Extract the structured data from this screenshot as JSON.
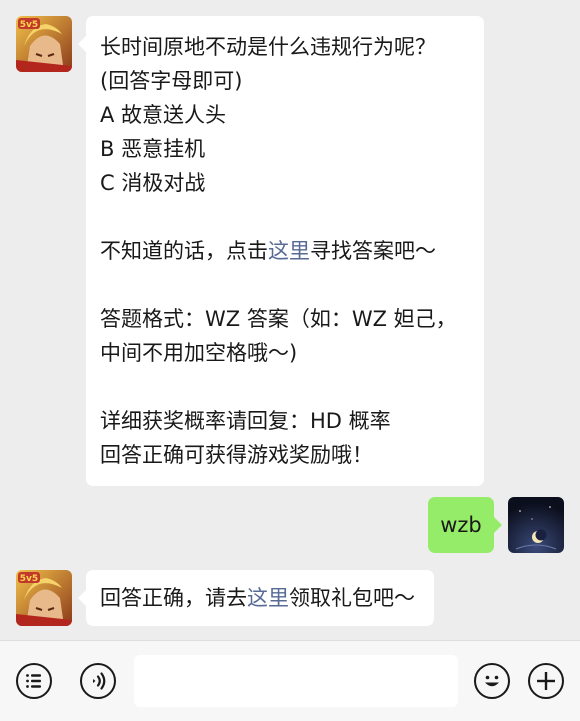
{
  "chat": {
    "message1": {
      "sender": "game-account",
      "lines": [
        "长时间原地不动是什么违规行为呢？",
        "(回答字母即可)",
        "A 故意送人头",
        "B 恶意挂机",
        "C 消极对战",
        "",
        "",
        "",
        "答题格式：WZ 答案（如：WZ 妲己，",
        "中间不用加空格哦～)",
        "",
        "详细获奖概率请回复：HD 概率",
        "回答正确可获得游戏奖励哦！"
      ],
      "hint_prefix": "不知道的话，点击",
      "hint_link": "这里",
      "hint_suffix": "寻找答案吧～"
    },
    "message2": {
      "sender": "user",
      "text": "wzb"
    },
    "message3": {
      "sender": "game-account",
      "prefix": "回答正确，请去",
      "link": "这里",
      "suffix": "领取礼包吧～"
    },
    "game_avatar_badge": "5v5"
  },
  "colors": {
    "background": "#ededed",
    "incoming_bubble": "#ffffff",
    "outgoing_bubble": "#95ec69",
    "link": "#576b95"
  },
  "toolbar": {
    "icons": [
      "menu-icon",
      "voice-icon",
      "emoji-icon",
      "plus-icon"
    ]
  }
}
